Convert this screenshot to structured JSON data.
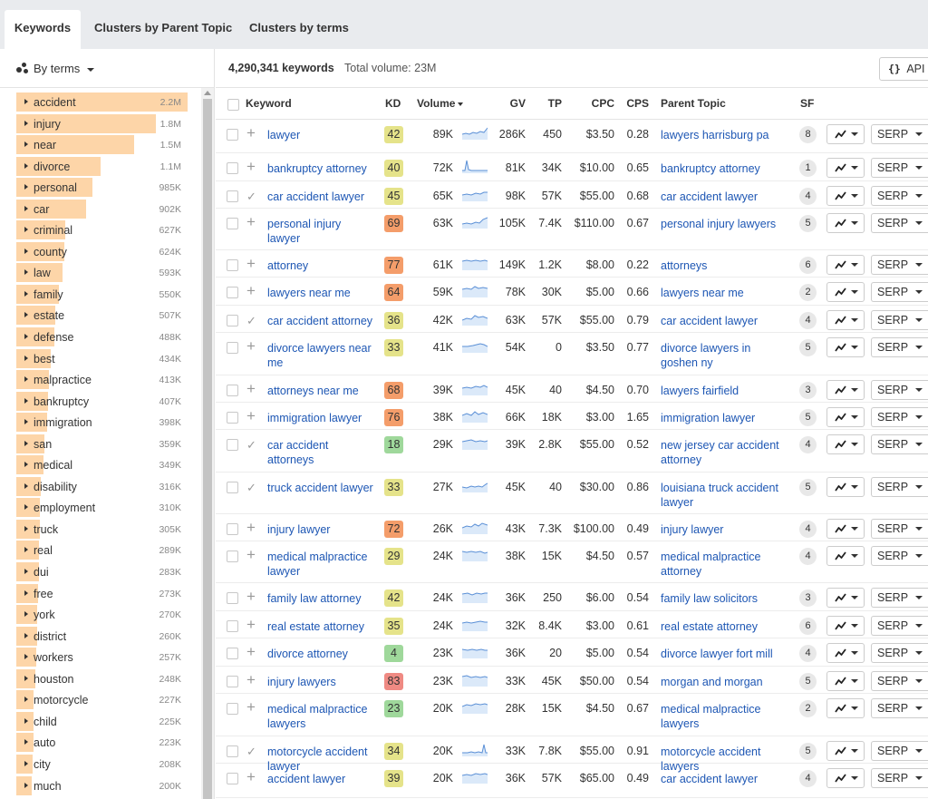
{
  "tabs": [
    {
      "label": "Keywords",
      "active": true
    },
    {
      "label": "Clusters by Parent Topic",
      "active": false
    },
    {
      "label": "Clusters by terms",
      "active": false
    }
  ],
  "sidebar": {
    "group_label": "By terms",
    "terms": [
      {
        "term": "accident",
        "count": "2.2M",
        "share": 1.0
      },
      {
        "term": "injury",
        "count": "1.8M",
        "share": 0.815
      },
      {
        "term": "near",
        "count": "1.5M",
        "share": 0.69
      },
      {
        "term": "divorce",
        "count": "1.1M",
        "share": 0.49
      },
      {
        "term": "personal",
        "count": "985K",
        "share": 0.445
      },
      {
        "term": "car",
        "count": "902K",
        "share": 0.41
      },
      {
        "term": "criminal",
        "count": "627K",
        "share": 0.285
      },
      {
        "term": "county",
        "count": "624K",
        "share": 0.28
      },
      {
        "term": "law",
        "count": "593K",
        "share": 0.27
      },
      {
        "term": "family",
        "count": "550K",
        "share": 0.25
      },
      {
        "term": "estate",
        "count": "507K",
        "share": 0.23
      },
      {
        "term": "defense",
        "count": "488K",
        "share": 0.22
      },
      {
        "term": "best",
        "count": "434K",
        "share": 0.2
      },
      {
        "term": "malpractice",
        "count": "413K",
        "share": 0.19
      },
      {
        "term": "bankruptcy",
        "count": "407K",
        "share": 0.185
      },
      {
        "term": "immigration",
        "count": "398K",
        "share": 0.18
      },
      {
        "term": "san",
        "count": "359K",
        "share": 0.165
      },
      {
        "term": "medical",
        "count": "349K",
        "share": 0.16
      },
      {
        "term": "disability",
        "count": "316K",
        "share": 0.145
      },
      {
        "term": "employment",
        "count": "310K",
        "share": 0.14
      },
      {
        "term": "truck",
        "count": "305K",
        "share": 0.14
      },
      {
        "term": "real",
        "count": "289K",
        "share": 0.13
      },
      {
        "term": "dui",
        "count": "283K",
        "share": 0.13
      },
      {
        "term": "free",
        "count": "273K",
        "share": 0.125
      },
      {
        "term": "york",
        "count": "270K",
        "share": 0.12
      },
      {
        "term": "district",
        "count": "260K",
        "share": 0.12
      },
      {
        "term": "workers",
        "count": "257K",
        "share": 0.115
      },
      {
        "term": "houston",
        "count": "248K",
        "share": 0.11
      },
      {
        "term": "motorcycle",
        "count": "227K",
        "share": 0.1
      },
      {
        "term": "child",
        "count": "225K",
        "share": 0.1
      },
      {
        "term": "auto",
        "count": "223K",
        "share": 0.1
      },
      {
        "term": "city",
        "count": "208K",
        "share": 0.095
      },
      {
        "term": "much",
        "count": "200K",
        "share": 0.09
      }
    ]
  },
  "summary": {
    "count": "4,290,341 keywords",
    "total_volume": "Total volume: 23M",
    "api_label": "API"
  },
  "columns": {
    "keyword": "Keyword",
    "kd": "KD",
    "volume": "Volume",
    "gv": "GV",
    "tp": "TP",
    "cpc": "CPC",
    "cps": "CPS",
    "parent_topic": "Parent Topic",
    "sf": "SF"
  },
  "serp_label": "SERP",
  "colors": {
    "kd_easy": "#9fd89b",
    "kd_medium": "#e5e38a",
    "kd_hard": "#f7c26b",
    "kd_harder": "#f49d6a",
    "kd_hardest": "#ef8a83",
    "term_bar": "#fdd5a8",
    "link": "#1e57b4"
  },
  "rows": [
    {
      "keyword": "lawyer",
      "action": "add",
      "kd": "42",
      "kd_level": "kd_medium",
      "volume": "89K",
      "gv": "286K",
      "tp": "450",
      "cpc": "$3.50",
      "cps": "0.28",
      "parent_topic": "lawyers harrisburg pa",
      "sf": "8"
    },
    {
      "keyword": "bankruptcy attorney",
      "action": "add",
      "kd": "40",
      "kd_level": "kd_medium",
      "volume": "72K",
      "gv": "81K",
      "tp": "34K",
      "cpc": "$10.00",
      "cps": "0.65",
      "parent_topic": "bankruptcy attorney",
      "sf": "1"
    },
    {
      "keyword": "car accident lawyer",
      "action": "added",
      "kd": "45",
      "kd_level": "kd_medium",
      "volume": "65K",
      "gv": "98K",
      "tp": "57K",
      "cpc": "$55.00",
      "cps": "0.68",
      "parent_topic": "car accident lawyer",
      "sf": "4"
    },
    {
      "keyword": "personal injury lawyer",
      "action": "add",
      "kd": "69",
      "kd_level": "kd_harder",
      "volume": "63K",
      "gv": "105K",
      "tp": "7.4K",
      "cpc": "$110.00",
      "cps": "0.67",
      "parent_topic": "personal injury lawyers",
      "sf": "5"
    },
    {
      "keyword": "attorney",
      "action": "add",
      "kd": "77",
      "kd_level": "kd_harder",
      "volume": "61K",
      "gv": "149K",
      "tp": "1.2K",
      "cpc": "$8.00",
      "cps": "0.22",
      "parent_topic": "attorneys",
      "sf": "6"
    },
    {
      "keyword": "lawyers near me",
      "action": "add",
      "kd": "64",
      "kd_level": "kd_harder",
      "volume": "59K",
      "gv": "78K",
      "tp": "30K",
      "cpc": "$5.00",
      "cps": "0.66",
      "parent_topic": "lawyers near me",
      "sf": "2"
    },
    {
      "keyword": "car accident attorney",
      "action": "added",
      "kd": "36",
      "kd_level": "kd_medium",
      "volume": "42K",
      "gv": "63K",
      "tp": "57K",
      "cpc": "$55.00",
      "cps": "0.79",
      "parent_topic": "car accident lawyer",
      "sf": "4"
    },
    {
      "keyword": "divorce lawyers near me",
      "action": "add",
      "kd": "33",
      "kd_level": "kd_medium",
      "volume": "41K",
      "gv": "54K",
      "tp": "0",
      "cpc": "$3.50",
      "cps": "0.77",
      "parent_topic": "divorce lawyers in goshen ny",
      "sf": "5"
    },
    {
      "keyword": "attorneys near me",
      "action": "add",
      "kd": "68",
      "kd_level": "kd_harder",
      "volume": "39K",
      "gv": "45K",
      "tp": "40",
      "cpc": "$4.50",
      "cps": "0.70",
      "parent_topic": "lawyers fairfield",
      "sf": "3"
    },
    {
      "keyword": "immigration lawyer",
      "action": "add",
      "kd": "76",
      "kd_level": "kd_harder",
      "volume": "38K",
      "gv": "66K",
      "tp": "18K",
      "cpc": "$3.00",
      "cps": "1.65",
      "parent_topic": "immigration lawyer",
      "sf": "5"
    },
    {
      "keyword": "car accident attorneys",
      "action": "added",
      "kd": "18",
      "kd_level": "kd_easy",
      "volume": "29K",
      "gv": "39K",
      "tp": "2.8K",
      "cpc": "$55.00",
      "cps": "0.52",
      "parent_topic": "new jersey car accident attorney",
      "sf": "4"
    },
    {
      "keyword": "truck accident lawyer",
      "action": "added",
      "kd": "33",
      "kd_level": "kd_medium",
      "volume": "27K",
      "gv": "45K",
      "tp": "40",
      "cpc": "$30.00",
      "cps": "0.86",
      "parent_topic": "louisiana truck accident lawyer",
      "sf": "5"
    },
    {
      "keyword": "injury lawyer",
      "action": "add",
      "kd": "72",
      "kd_level": "kd_harder",
      "volume": "26K",
      "gv": "43K",
      "tp": "7.3K",
      "cpc": "$100.00",
      "cps": "0.49",
      "parent_topic": "injury lawyer",
      "sf": "4"
    },
    {
      "keyword": "medical malpractice lawyer",
      "action": "add",
      "kd": "29",
      "kd_level": "kd_medium",
      "volume": "24K",
      "gv": "38K",
      "tp": "15K",
      "cpc": "$4.50",
      "cps": "0.57",
      "parent_topic": "medical malpractice attorney",
      "sf": "4"
    },
    {
      "keyword": "family law attorney",
      "action": "add",
      "kd": "42",
      "kd_level": "kd_medium",
      "volume": "24K",
      "gv": "36K",
      "tp": "250",
      "cpc": "$6.00",
      "cps": "0.54",
      "parent_topic": "family law solicitors",
      "sf": "3"
    },
    {
      "keyword": "real estate attorney",
      "action": "add",
      "kd": "35",
      "kd_level": "kd_medium",
      "volume": "24K",
      "gv": "32K",
      "tp": "8.4K",
      "cpc": "$3.00",
      "cps": "0.61",
      "parent_topic": "real estate attorney",
      "sf": "6"
    },
    {
      "keyword": "divorce attorney",
      "action": "add",
      "kd": "4",
      "kd_level": "kd_easy",
      "volume": "23K",
      "gv": "36K",
      "tp": "20",
      "cpc": "$5.00",
      "cps": "0.54",
      "parent_topic": "divorce lawyer fort mill",
      "sf": "4"
    },
    {
      "keyword": "injury lawyers",
      "action": "add",
      "kd": "83",
      "kd_level": "kd_hardest",
      "volume": "23K",
      "gv": "33K",
      "tp": "45K",
      "cpc": "$50.00",
      "cps": "0.54",
      "parent_topic": "morgan and morgan",
      "sf": "5"
    },
    {
      "keyword": "medical malpractice lawyers",
      "action": "add",
      "kd": "23",
      "kd_level": "kd_easy",
      "volume": "20K",
      "gv": "28K",
      "tp": "15K",
      "cpc": "$4.50",
      "cps": "0.67",
      "parent_topic": "medical malpractice lawyers",
      "sf": "2"
    },
    {
      "keyword": "motorcycle accident lawyer",
      "action": "added",
      "kd": "34",
      "kd_level": "kd_medium",
      "volume": "20K",
      "gv": "33K",
      "tp": "7.8K",
      "cpc": "$55.00",
      "cps": "0.91",
      "parent_topic": "motorcycle accident lawyers",
      "sf": "5"
    },
    {
      "keyword": "accident lawyer",
      "action": "add",
      "kd": "39",
      "kd_level": "kd_medium",
      "volume": "20K",
      "gv": "36K",
      "tp": "57K",
      "cpc": "$65.00",
      "cps": "0.49",
      "parent_topic": "car accident lawyer",
      "sf": "4"
    }
  ]
}
